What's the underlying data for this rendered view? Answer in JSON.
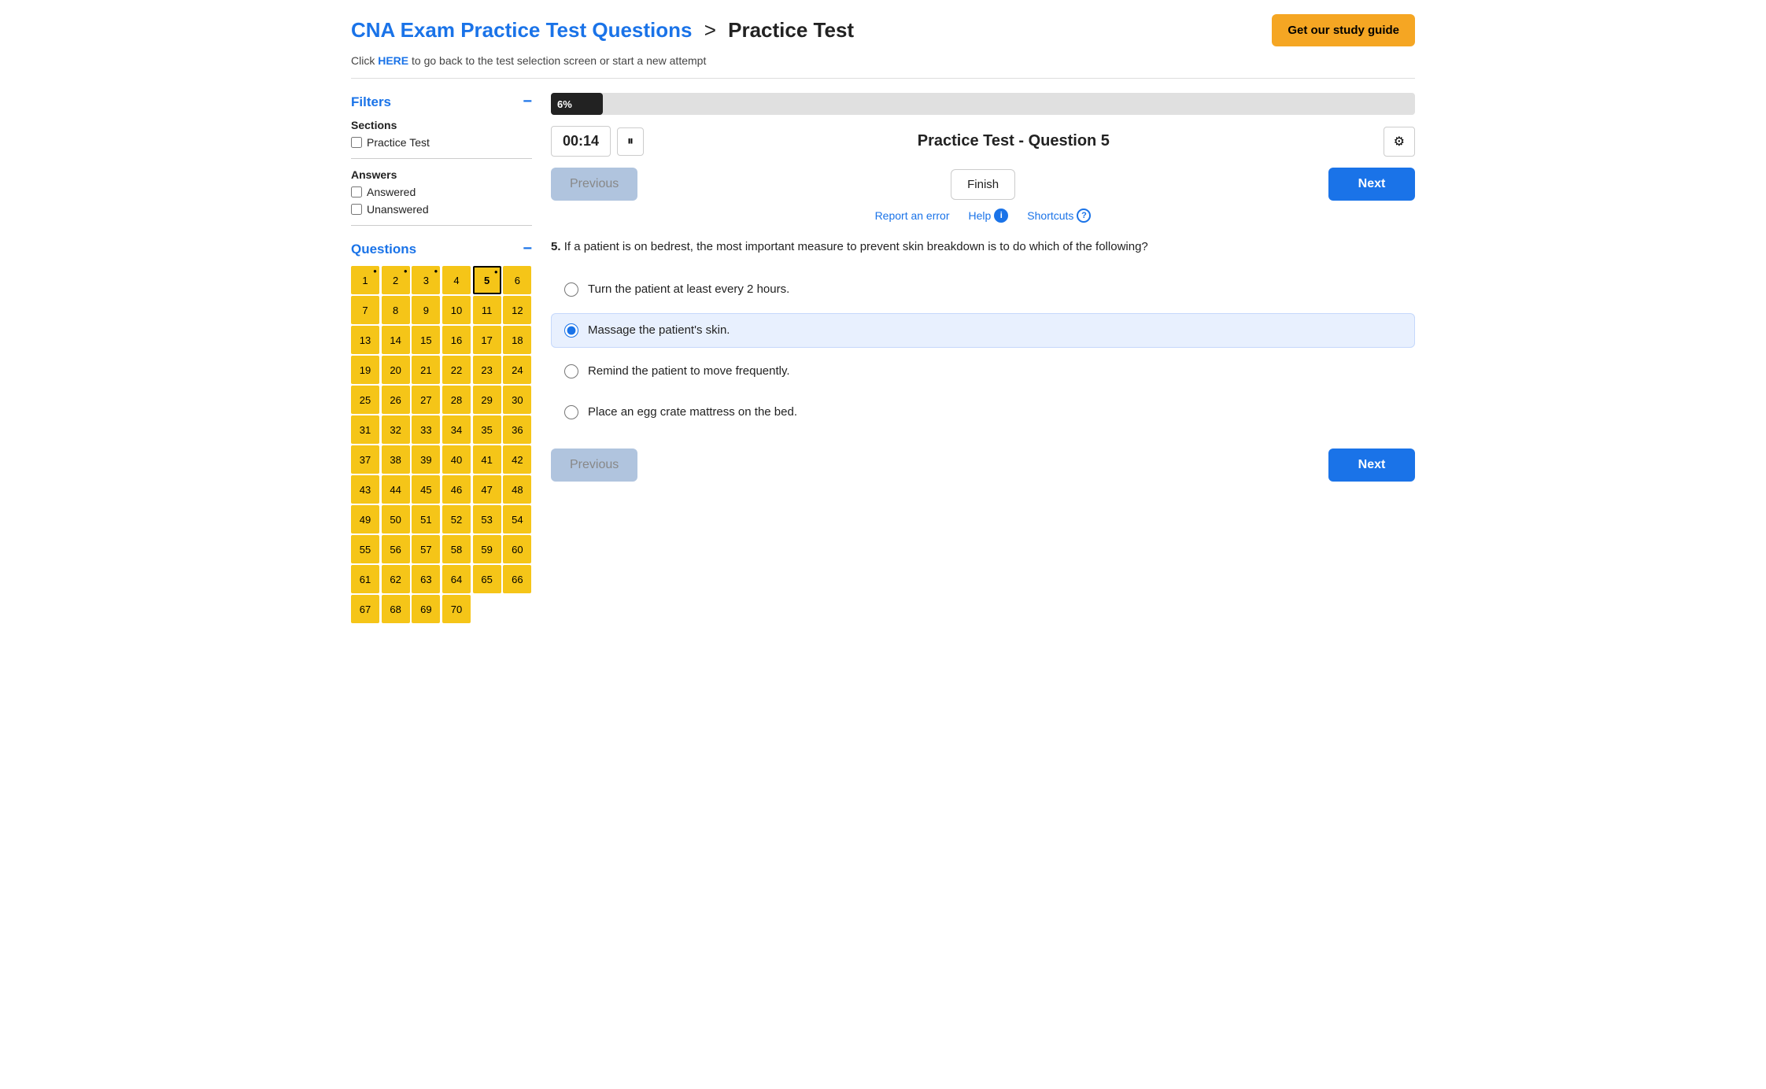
{
  "header": {
    "brand": "CNA Exam Practice Test Questions",
    "separator": ">",
    "page_name": "Practice Test",
    "study_guide_label": "Get our study guide",
    "subheader_text": "Click ",
    "subheader_link": "HERE",
    "subheader_rest": " to go back to the test selection screen or start a new attempt"
  },
  "sidebar": {
    "filters_label": "Filters",
    "minus_icon": "−",
    "sections_label": "Sections",
    "sections_options": [
      {
        "label": "Practice Test",
        "checked": false
      }
    ],
    "answers_label": "Answers",
    "answers_options": [
      {
        "label": "Answered",
        "checked": false
      },
      {
        "label": "Unanswered",
        "checked": false
      }
    ],
    "questions_label": "Questions",
    "question_numbers": [
      1,
      2,
      3,
      4,
      5,
      6,
      7,
      8,
      9,
      10,
      11,
      12,
      13,
      14,
      15,
      16,
      17,
      18,
      19,
      20,
      21,
      22,
      23,
      24,
      25,
      26,
      27,
      28,
      29,
      30,
      31,
      32,
      33,
      34,
      35,
      36,
      37,
      38,
      39,
      40,
      41,
      42,
      43,
      44,
      45,
      46,
      47,
      48,
      49,
      50,
      51,
      52,
      53,
      54,
      55,
      56,
      57,
      58,
      59,
      60,
      61,
      62,
      63,
      64,
      65,
      66,
      67,
      68,
      69,
      70
    ],
    "flagged": [
      1,
      2,
      3,
      5
    ],
    "active": 5
  },
  "progress": {
    "percent": 6,
    "label": "6%",
    "fill_width": "6%"
  },
  "timer": {
    "value": "00:14",
    "pause_icon": "⏸",
    "question_title": "Practice Test - Question 5",
    "settings_icon": "⚙"
  },
  "nav": {
    "previous_label": "Previous",
    "next_label": "Next",
    "finish_label": "Finish"
  },
  "help": {
    "report_label": "Report an error",
    "help_label": "Help",
    "help_icon": "i",
    "shortcuts_label": "Shortcuts",
    "shortcuts_icon": "?"
  },
  "question": {
    "number": "5.",
    "text": "If a patient is on bedrest, the most important measure to prevent skin breakdown is to do which of the following?",
    "options": [
      {
        "id": "a",
        "text": "Turn the patient at least every 2 hours.",
        "selected": false
      },
      {
        "id": "b",
        "text": "Massage the patient's skin.",
        "selected": true
      },
      {
        "id": "c",
        "text": "Remind the patient to move frequently.",
        "selected": false
      },
      {
        "id": "d",
        "text": "Place an egg crate mattress on the bed.",
        "selected": false
      }
    ]
  }
}
